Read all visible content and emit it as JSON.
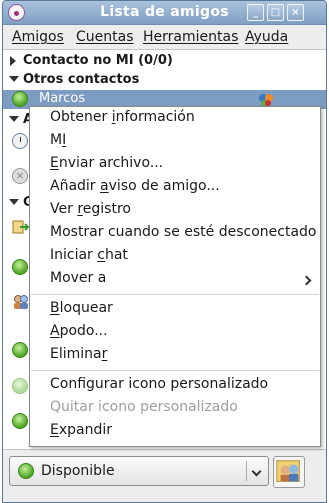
{
  "window": {
    "title": "Lista de amigos"
  },
  "menubar": {
    "items": [
      {
        "pre": "",
        "key": "A",
        "post": "migos"
      },
      {
        "pre": "",
        "key": "C",
        "post": "uentas"
      },
      {
        "pre": "",
        "key": "H",
        "post": "erramientas"
      },
      {
        "pre": "Ay",
        "key": "u",
        "post": "da"
      }
    ]
  },
  "groups": {
    "contacto_no_mi": "Contacto no MI (0/0)",
    "otros_contactos": "Otros contactos",
    "selected_contact": "Marcos",
    "hidden_group_1": "A",
    "hidden_group_2": "C"
  },
  "context_menu": {
    "items": [
      {
        "pre": "Obtener ",
        "key": "i",
        "post": "nformación",
        "enabled": true
      },
      {
        "pre": "M",
        "key": "I",
        "post": "",
        "enabled": true
      },
      {
        "pre": "",
        "key": "E",
        "post": "nviar archivo...",
        "enabled": true
      },
      {
        "pre": "Añadir ",
        "key": "a",
        "post": "viso de amigo...",
        "enabled": true
      },
      {
        "pre": "Ver ",
        "key": "r",
        "post": "egistro",
        "enabled": true
      },
      {
        "pre": "Mostrar cuando se esté desconectado",
        "key": "",
        "post": "",
        "enabled": true
      },
      {
        "pre": "Iniciar ",
        "key": "c",
        "post": "hat",
        "enabled": true
      },
      {
        "pre": "Mover a",
        "key": "",
        "post": "",
        "enabled": true,
        "submenu": true
      },
      {
        "pre": "",
        "key": "B",
        "post": "loquear",
        "enabled": true
      },
      {
        "pre": "",
        "key": "A",
        "post": "podo...",
        "enabled": true
      },
      {
        "pre": "Elimina",
        "key": "r",
        "post": "",
        "enabled": true
      },
      {
        "pre": "Configurar icono personalizado",
        "key": "",
        "post": "",
        "enabled": true
      },
      {
        "pre": "Quitar icono personalizado",
        "key": "",
        "post": "",
        "enabled": false
      },
      {
        "pre": "",
        "key": "E",
        "post": "xpandir",
        "enabled": true
      }
    ]
  },
  "status": {
    "label": "Disponible"
  },
  "icons": {
    "title": "pidgin-icon",
    "status_available": "green-circle-icon",
    "buddy_icon": "buddy-pounce-icon"
  },
  "colors": {
    "selection": "#7d9cc2",
    "titlebar": "#8fa9cb"
  }
}
